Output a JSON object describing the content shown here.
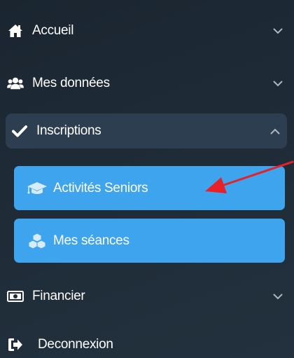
{
  "menu": {
    "accueil": {
      "label": "Accueil",
      "icon": "home-icon"
    },
    "donnees": {
      "label": "Mes données",
      "icon": "users-icon"
    },
    "inscriptions": {
      "label": "Inscriptions",
      "icon": "check-icon",
      "expanded": true,
      "submenu": {
        "activites": {
          "label": "Activités Seniors",
          "icon": "graduation-cap-icon"
        },
        "seances": {
          "label": "Mes séances",
          "icon": "cubes-icon"
        }
      }
    },
    "financier": {
      "label": "Financier",
      "icon": "money-icon"
    },
    "deconnexion": {
      "label": "Deconnexion",
      "icon": "sign-out-icon"
    }
  },
  "colors": {
    "sidebar_background": "#1f2c38",
    "active_group_background": "#2c3e50",
    "submenu_background": "#3fa4ee",
    "annotation_arrow": "#e8202a",
    "text": "#ffffff",
    "chevron": "#aeb7c0"
  }
}
